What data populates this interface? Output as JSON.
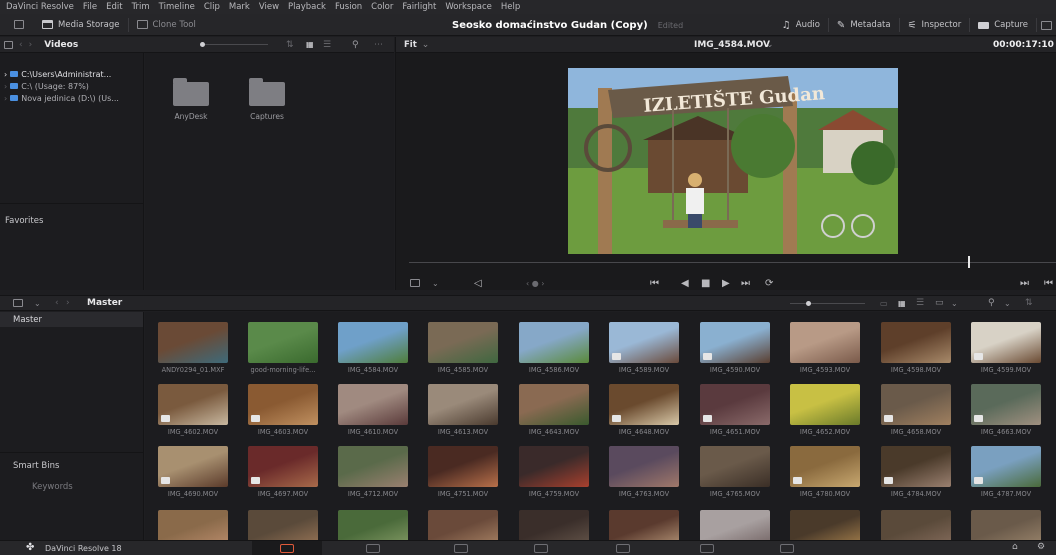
{
  "menubar": [
    "DaVinci Resolve",
    "File",
    "Edit",
    "Trim",
    "Timeline",
    "Clip",
    "Mark",
    "View",
    "Playback",
    "Fusion",
    "Color",
    "Fairlight",
    "Workspace",
    "Help"
  ],
  "toolbar": {
    "media_storage": "Media Storage",
    "clone_tool": "Clone Tool",
    "project_name": "Seosko domaćinstvo Gudan (Copy)",
    "project_status": "Edited",
    "audio": "Audio",
    "metadata": "Metadata",
    "inspector": "Inspector",
    "capture": "Capture"
  },
  "storage": {
    "title": "Videos",
    "drives": [
      "C:\\Users\\Administrat...",
      "C:\\ (Usage: 87%)",
      "Nova jedinica (D:\\) (Us..."
    ],
    "favorites": "Favorites",
    "folders": [
      "AnyDesk",
      "Captures"
    ]
  },
  "viewer": {
    "fit": "Fit",
    "clip_name": "IMG_4584.MOV",
    "timecode": "00:00:17:10",
    "sign_text": "IZLETIŠTE Gudan"
  },
  "bins": {
    "header": "Master",
    "master": "Master",
    "smart_bins": "Smart Bins",
    "keywords": "Keywords"
  },
  "clips": [
    {
      "name": "ANDY0294_01.MXF",
      "c1": "#6a4a36",
      "c2": "#3e6a7a",
      "badge": false
    },
    {
      "name": "good-morning-life...",
      "c1": "#5a8a4a",
      "c2": "#3a6a2e",
      "badge": false
    },
    {
      "name": "IMG_4584.MOV",
      "c1": "#6fa0c9",
      "c2": "#4f7d3a",
      "badge": false
    },
    {
      "name": "IMG_4585.MOV",
      "c1": "#7a6a55",
      "c2": "#3f6840",
      "badge": false
    },
    {
      "name": "IMG_4586.MOV",
      "c1": "#86a8c8",
      "c2": "#5a8a3a",
      "badge": false
    },
    {
      "name": "IMG_4589.MOV",
      "c1": "#9ab8d6",
      "c2": "#6a4a3a",
      "badge": true
    },
    {
      "name": "IMG_4590.MOV",
      "c1": "#8ab0d0",
      "c2": "#5a3f30",
      "badge": true
    },
    {
      "name": "IMG_4593.MOV",
      "c1": "#b89a86",
      "c2": "#7a5a4a",
      "badge": false
    },
    {
      "name": "IMG_4598.MOV",
      "c1": "#5e3f2a",
      "c2": "#a88a6a",
      "badge": false
    },
    {
      "name": "IMG_4599.MOV",
      "c1": "#d8d2c6",
      "c2": "#6a4a32",
      "badge": true
    },
    {
      "name": "IMG_4602.MOV",
      "c1": "#7a5a3e",
      "c2": "#c8b8a0",
      "badge": true
    },
    {
      "name": "IMG_4603.MOV",
      "c1": "#8a5a32",
      "c2": "#c09060",
      "badge": true
    },
    {
      "name": "IMG_4610.MOV",
      "c1": "#a08a80",
      "c2": "#5a3a3a",
      "badge": false
    },
    {
      "name": "IMG_4613.MOV",
      "c1": "#9a8a7a",
      "c2": "#4a3a2e",
      "badge": false
    },
    {
      "name": "IMG_4643.MOV",
      "c1": "#8a6a52",
      "c2": "#3a5a2e",
      "badge": false
    },
    {
      "name": "IMG_4648.MOV",
      "c1": "#6a4a2e",
      "c2": "#d8c8a8",
      "badge": true
    },
    {
      "name": "IMG_4651.MOV",
      "c1": "#5a3a3e",
      "c2": "#8a6a6a",
      "badge": true
    },
    {
      "name": "IMG_4652.MOV",
      "c1": "#c8c044",
      "c2": "#6a7a2a",
      "badge": false
    },
    {
      "name": "IMG_4658.MOV",
      "c1": "#6a5a4a",
      "c2": "#a08060",
      "badge": true
    },
    {
      "name": "IMG_4663.MOV",
      "c1": "#5a6a5a",
      "c2": "#a09080",
      "badge": true
    },
    {
      "name": "IMG_4690.MOV",
      "c1": "#a89070",
      "c2": "#5a3a2a",
      "badge": true
    },
    {
      "name": "IMG_4697.MOV",
      "c1": "#6a2a2a",
      "c2": "#a86a4a",
      "badge": true
    },
    {
      "name": "IMG_4712.MOV",
      "c1": "#5a6a4a",
      "c2": "#9a8070",
      "badge": false
    },
    {
      "name": "IMG_4751.MOV",
      "c1": "#4a2a22",
      "c2": "#b8704a",
      "badge": false
    },
    {
      "name": "IMG_4759.MOV",
      "c1": "#3a2a2a",
      "c2": "#a8402e",
      "badge": false
    },
    {
      "name": "IMG_4763.MOV",
      "c1": "#5a4a5e",
      "c2": "#a0786a",
      "badge": false
    },
    {
      "name": "IMG_4765.MOV",
      "c1": "#6a5a4a",
      "c2": "#3a2e26",
      "badge": false
    },
    {
      "name": "IMG_4780.MOV",
      "c1": "#8a6a3e",
      "c2": "#c8a870",
      "badge": true
    },
    {
      "name": "IMG_4784.MOV",
      "c1": "#4a3a2a",
      "c2": "#9a8070",
      "badge": true
    },
    {
      "name": "IMG_4787.MOV",
      "c1": "#7aa0c0",
      "c2": "#4a6a3a",
      "badge": true
    },
    {
      "name": "",
      "c1": "#8a6a4a",
      "c2": "#c09070",
      "badge": false
    },
    {
      "name": "",
      "c1": "#5a4a3a",
      "c2": "#a07a5a",
      "badge": false
    },
    {
      "name": "",
      "c1": "#4a6a3a",
      "c2": "#8aa06a",
      "badge": false
    },
    {
      "name": "",
      "c1": "#6a4a3a",
      "c2": "#b08a6a",
      "badge": false
    },
    {
      "name": "",
      "c1": "#3a2e2a",
      "c2": "#6a5a4e",
      "badge": false
    },
    {
      "name": "",
      "c1": "#5a3a2e",
      "c2": "#c0a080",
      "badge": false
    },
    {
      "name": "",
      "c1": "#a8a0a0",
      "c2": "#6a5a5a",
      "badge": false
    },
    {
      "name": "",
      "c1": "#4a3a2a",
      "c2": "#b08850",
      "badge": false
    },
    {
      "name": "",
      "c1": "#5a4a3a",
      "c2": "#8a7060",
      "badge": false
    },
    {
      "name": "",
      "c1": "#6a5a4a",
      "c2": "#a08a70",
      "badge": false
    }
  ],
  "pagebar": {
    "app_name": "DaVinci Resolve 18"
  },
  "colors": {
    "accent": "#4a8fe0",
    "panel": "#1c1c1f",
    "header": "#262629"
  }
}
